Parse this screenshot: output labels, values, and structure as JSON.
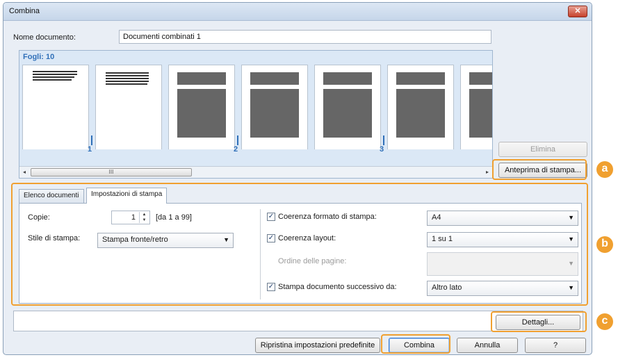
{
  "window": {
    "title": "Combina",
    "close_glyph": "✕"
  },
  "document_name": {
    "label": "Nome documento:",
    "value": "Documenti combinati 1"
  },
  "preview": {
    "sheets_label": "Fogli: 10",
    "doc_numbers": [
      "1",
      "2",
      "3"
    ],
    "scroll_left": "◂",
    "scroll_right": "▸",
    "scroll_grip": "III"
  },
  "side_buttons": {
    "delete": "Elimina",
    "print_preview": "Anteprima di stampa..."
  },
  "badges": [
    "a",
    "b",
    "c"
  ],
  "tabs": [
    {
      "label": "Elenco documenti",
      "active": false
    },
    {
      "label": "Impostazioni di stampa",
      "active": true
    }
  ],
  "print_settings": {
    "copies_label": "Copie:",
    "copies_value": "1",
    "copies_range": "[da 1 a 99]",
    "print_style_label": "Stile di stampa:",
    "print_style_value": "Stampa fronte/retro",
    "paper_consistency_label": "Coerenza formato di stampa:",
    "paper_consistency_value": "A4",
    "layout_consistency_label": "Coerenza layout:",
    "layout_consistency_value": "1 su 1",
    "page_order_label": "Ordine delle pagine:",
    "page_order_value": "",
    "next_doc_label": "Stampa documento successivo da:",
    "next_doc_value": "Altro lato",
    "check_glyph": "✓",
    "dropdown_glyph": "▼"
  },
  "details_button": "Dettagli...",
  "footer": {
    "restore": "Ripristina impostazioni predefinite",
    "combine": "Combina",
    "cancel": "Annulla",
    "help": "?"
  },
  "colors": {
    "accent_orange": "#f0a030",
    "link_blue": "#2f6fb8"
  }
}
